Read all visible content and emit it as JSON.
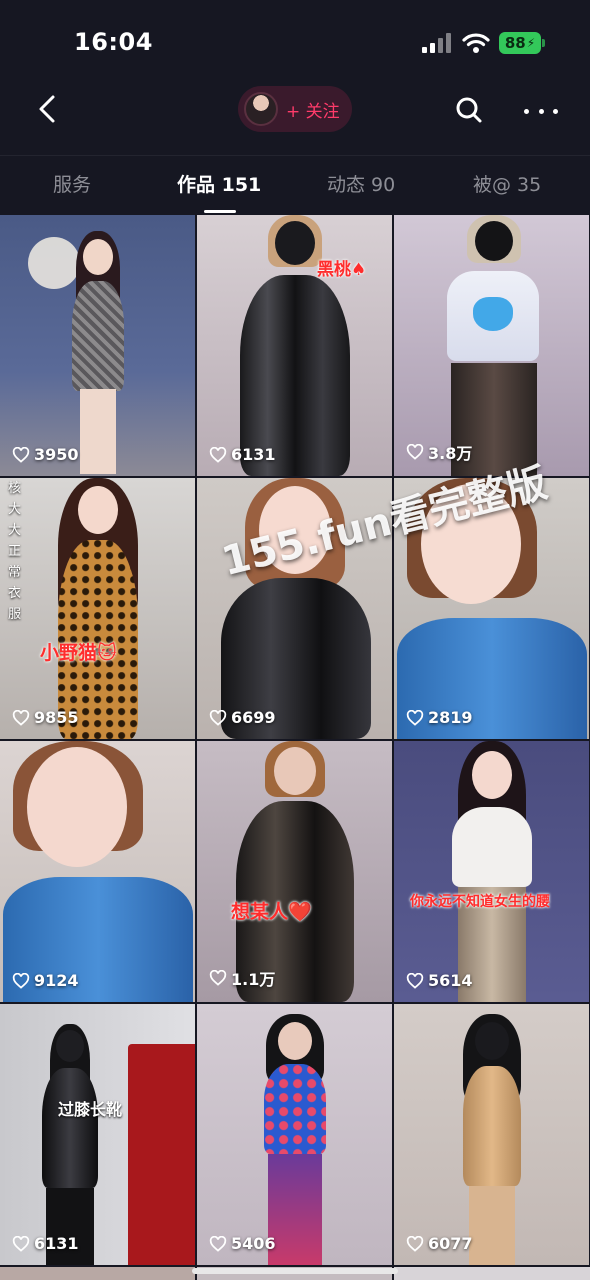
{
  "status": {
    "time": "16:04",
    "battery": "88"
  },
  "nav": {
    "follow_label": "+ 关注"
  },
  "tabs": [
    {
      "label": "服务"
    },
    {
      "label": "作品 151"
    },
    {
      "label": "动态 90"
    },
    {
      "label": "被@ 35"
    }
  ],
  "grid": [
    {
      "likes": "3950"
    },
    {
      "likes": "6131",
      "caption": "黑桃♠"
    },
    {
      "likes": "3.8万"
    },
    {
      "likes": "9855",
      "caption": "小野猫🐱",
      "side_text": "核大大正常衣服"
    },
    {
      "likes": "6699"
    },
    {
      "likes": "2819"
    },
    {
      "likes": "9124"
    },
    {
      "likes": "1.1万",
      "caption": "想某人❤️"
    },
    {
      "likes": "5614",
      "caption": "你永远不知道女生的腰"
    },
    {
      "likes": "6131",
      "caption": "过膝长靴"
    },
    {
      "likes": "5406"
    },
    {
      "likes": "6077"
    }
  ],
  "watermark": "155.fun看完整版",
  "colors": {
    "accent": "#ff3b6a",
    "battery": "#33c85a",
    "background": "#161722"
  }
}
